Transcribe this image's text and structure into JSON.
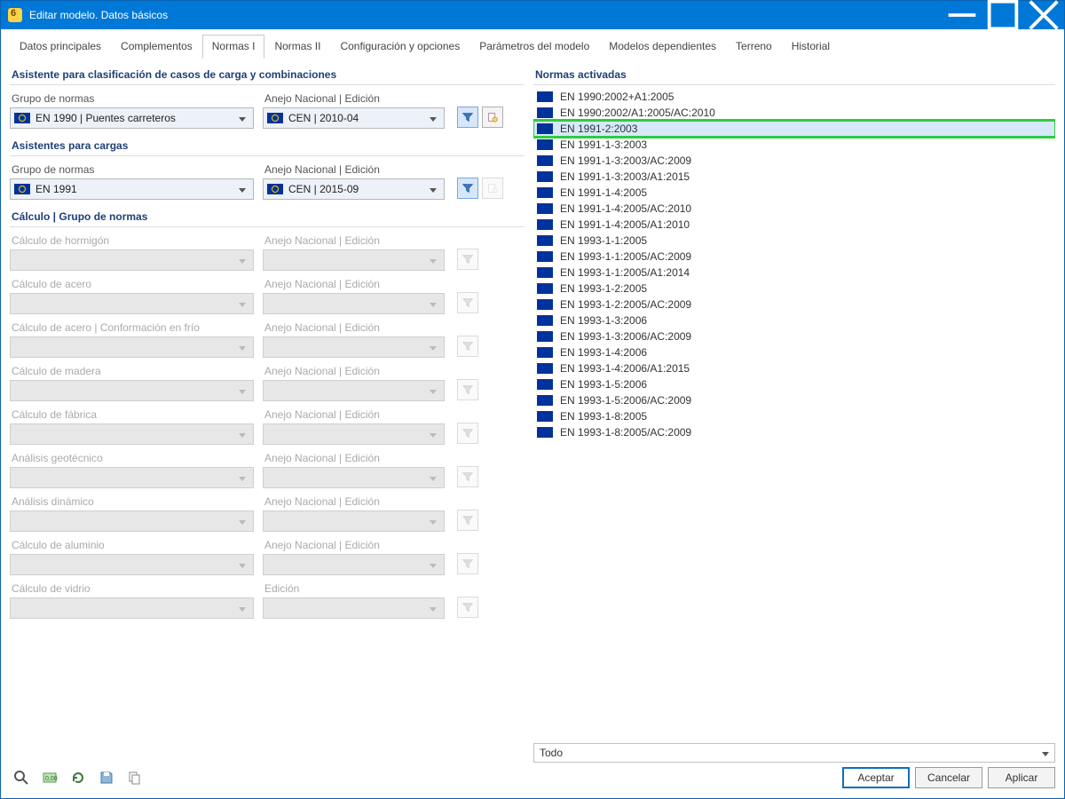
{
  "window": {
    "title": "Editar modelo. Datos básicos"
  },
  "tabs": [
    {
      "label": "Datos principales"
    },
    {
      "label": "Complementos"
    },
    {
      "label": "Normas I"
    },
    {
      "label": "Normas II"
    },
    {
      "label": "Configuración y opciones"
    },
    {
      "label": "Parámetros del modelo"
    },
    {
      "label": "Modelos dependientes"
    },
    {
      "label": "Terreno"
    },
    {
      "label": "Historial"
    }
  ],
  "activeTab": 2,
  "left": {
    "sec1_title": "Asistente para clasificación de casos de carga y combinaciones",
    "sec1_group_label": "Grupo de normas",
    "sec1_group_value": "EN 1990 | Puentes carreteros",
    "sec1_annex_label": "Anejo Nacional | Edición",
    "sec1_annex_value": "CEN | 2010-04",
    "sec2_title": "Asistentes para cargas",
    "sec2_group_label": "Grupo de normas",
    "sec2_group_value": "EN 1991",
    "sec2_annex_label": "Anejo Nacional | Edición",
    "sec2_annex_value": "CEN | 2015-09",
    "sec3_title": "Cálculo | Grupo de normas",
    "annex_label": "Anejo Nacional | Edición",
    "edition_label": "Edición",
    "rows": [
      {
        "label": "Cálculo de hormigón"
      },
      {
        "label": "Cálculo de acero"
      },
      {
        "label": "Cálculo de acero | Conformación en frío"
      },
      {
        "label": "Cálculo de madera"
      },
      {
        "label": "Cálculo de fábrica"
      },
      {
        "label": "Análisis geotécnico"
      },
      {
        "label": "Análisis dinámico"
      },
      {
        "label": "Cálculo de aluminio"
      },
      {
        "label": "Cálculo de vidrio"
      }
    ]
  },
  "right": {
    "title": "Normas activadas",
    "items": [
      "EN 1990:2002+A1:2005",
      "EN 1990:2002/A1:2005/AC:2010",
      "EN 1991-2:2003",
      "EN 1991-1-3:2003",
      "EN 1991-1-3:2003/AC:2009",
      "EN 1991-1-3:2003/A1:2015",
      "EN 1991-1-4:2005",
      "EN 1991-1-4:2005/AC:2010",
      "EN 1991-1-4:2005/A1:2010",
      "EN 1993-1-1:2005",
      "EN 1993-1-1:2005/AC:2009",
      "EN 1993-1-1:2005/A1:2014",
      "EN 1993-1-2:2005",
      "EN 1993-1-2:2005/AC:2009",
      "EN 1993-1-3:2006",
      "EN 1993-1-3:2006/AC:2009",
      "EN 1993-1-4:2006",
      "EN 1993-1-4:2006/A1:2015",
      "EN 1993-1-5:2006",
      "EN 1993-1-5:2006/AC:2009",
      "EN 1993-1-8:2005",
      "EN 1993-1-8:2005/AC:2009"
    ],
    "highlighted_index": 2,
    "filter_value": "Todo"
  },
  "footer": {
    "ok": "Aceptar",
    "cancel": "Cancelar",
    "apply": "Aplicar"
  }
}
